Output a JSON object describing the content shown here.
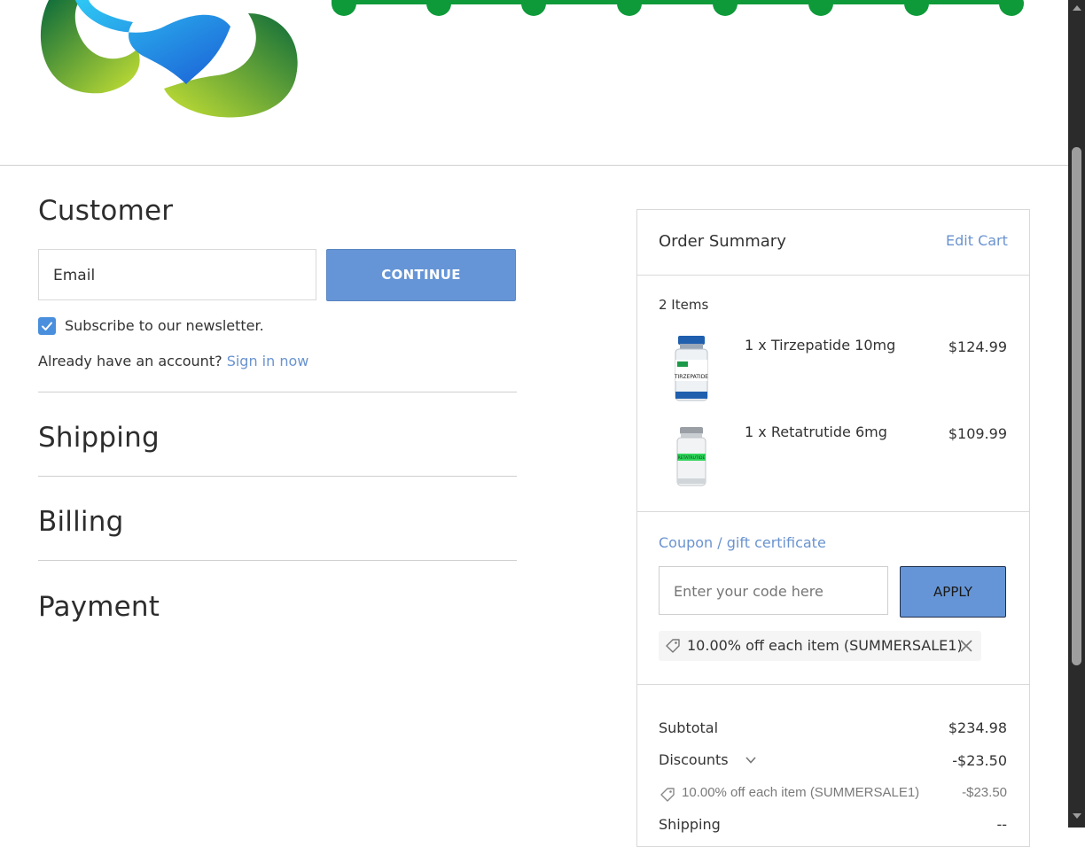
{
  "customer": {
    "title": "Customer",
    "email_placeholder": "Email",
    "continue_label": "CONTINUE",
    "newsletter_label": "Subscribe to our newsletter.",
    "newsletter_checked": true,
    "account_prompt": "Already have an account?",
    "sign_in_label": "Sign in now"
  },
  "sections": {
    "shipping": "Shipping",
    "billing": "Billing",
    "payment": "Payment"
  },
  "order_summary": {
    "title": "Order Summary",
    "edit_cart_label": "Edit Cart",
    "items_count": "2 Items",
    "items": [
      {
        "name": "1 x Tirzepatide 10mg",
        "price": "$124.99",
        "label_text": "TIRZEPATIDE"
      },
      {
        "name": "1 x Retatrutide 6mg",
        "price": "$109.99",
        "label_text": "RETATRUTIDE"
      }
    ],
    "coupon_link": "Coupon / gift certificate",
    "coupon_placeholder": "Enter your code here",
    "apply_label": "APPLY",
    "applied_coupon": "10.00% off each item (SUMMERSALE1)",
    "subtotal_label": "Subtotal",
    "subtotal_value": "$234.98",
    "discounts_label": "Discounts",
    "discounts_value": "-$23.50",
    "discount_detail_label": "10.00% off each item (SUMMERSALE1)",
    "discount_detail_value": "-$23.50",
    "shipping_label": "Shipping",
    "shipping_value": "--"
  },
  "colors": {
    "accent": "#6595d6",
    "link": "#6a93cf",
    "brand_green": "#0f9a3a"
  }
}
